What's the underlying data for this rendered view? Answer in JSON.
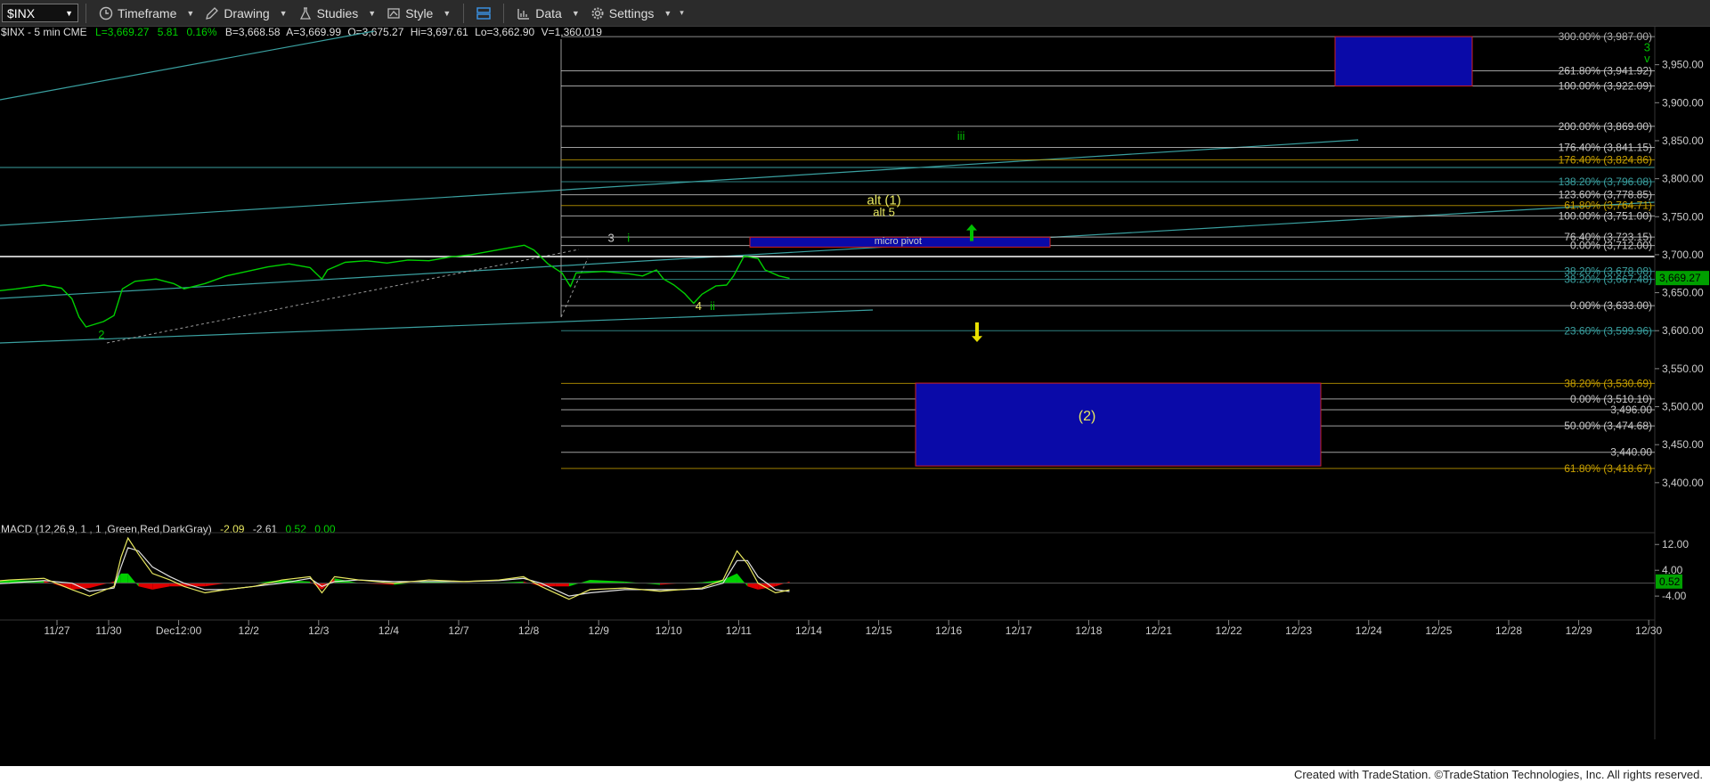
{
  "toolbar": {
    "symbol": "$INX",
    "timeframe": "Timeframe",
    "drawing": "Drawing",
    "studies": "Studies",
    "style": "Style",
    "data": "Data",
    "settings": "Settings"
  },
  "header": {
    "symbol_info": "$INX - 5 min  CME",
    "last": "L=3,669.27",
    "change": "5.81",
    "pct": "0.16%",
    "bid": "B=3,668.58",
    "ask": "A=3,669.99",
    "open": "O=3,675.27",
    "high": "Hi=3,697.61",
    "low": "Lo=3,662.90",
    "volume": "V=1,360,019"
  },
  "footer": {
    "credit": "Created with TradeStation. ©TradeStation Technologies, Inc. All rights reserved."
  },
  "colors": {
    "up": "#00d000",
    "down": "#e00000",
    "signal": "#e8e860",
    "fib_teal": "#3aa0a0",
    "box_blue": "#0a0aa8"
  },
  "chart_data": {
    "type": "line",
    "title": "$INX - 5 min",
    "price_axis": {
      "ylim": [
        3367,
        4000
      ],
      "ticks": [
        "3,950.00",
        "3,900.00",
        "3,850.00",
        "3,800.00",
        "3,750.00",
        "3,700.00",
        "3,650.00",
        "3,600.00",
        "3,550.00",
        "3,500.00",
        "3,450.00",
        "3,400.00"
      ],
      "tick_values": [
        3950,
        3900,
        3850,
        3800,
        3750,
        3700,
        3650,
        3600,
        3550,
        3500,
        3450,
        3400
      ],
      "last_price_label": "3,669.27",
      "last_price": 3669.27
    },
    "x_axis": {
      "labels": [
        "11/27",
        "11/30",
        "Dec12:00",
        "12/2",
        "12/3",
        "12/4",
        "12/7",
        "12/8",
        "12/9",
        "12/10",
        "12/11",
        "12/14",
        "12/15",
        "12/16",
        "12/17",
        "12/18",
        "12/21",
        "12/22",
        "12/23",
        "12/24",
        "12/25",
        "12/28",
        "12/29",
        "12/30"
      ],
      "index": [
        -1,
        0,
        1,
        2,
        3,
        4,
        5,
        6,
        7,
        8,
        9,
        10,
        11,
        12,
        13,
        14,
        15,
        16,
        17,
        18,
        19,
        20,
        21,
        22
      ]
    },
    "price_series": {
      "name": "$INX",
      "points": [
        [
          -2,
          3648
        ],
        [
          -1.7,
          3652
        ],
        [
          -1.4,
          3655
        ],
        [
          -1.0,
          3660
        ],
        [
          -0.75,
          3656
        ],
        [
          -0.6,
          3642
        ],
        [
          -0.5,
          3618
        ],
        [
          -0.4,
          3605
        ],
        [
          -0.15,
          3612
        ],
        [
          0.0,
          3620
        ],
        [
          0.12,
          3655
        ],
        [
          0.3,
          3665
        ],
        [
          0.6,
          3668
        ],
        [
          0.85,
          3662
        ],
        [
          1.0,
          3655
        ],
        [
          1.3,
          3662
        ],
        [
          1.6,
          3672
        ],
        [
          1.9,
          3678
        ],
        [
          2.2,
          3684
        ],
        [
          2.5,
          3688
        ],
        [
          2.8,
          3683
        ],
        [
          2.97,
          3668
        ],
        [
          3.05,
          3680
        ],
        [
          3.3,
          3690
        ],
        [
          3.6,
          3692
        ],
        [
          3.9,
          3689
        ],
        [
          4.2,
          3693
        ],
        [
          4.5,
          3692
        ],
        [
          4.8,
          3697
        ],
        [
          5.1,
          3700
        ],
        [
          5.4,
          3705
        ],
        [
          5.7,
          3710
        ],
        [
          5.86,
          3712.5
        ],
        [
          6.0,
          3706
        ],
        [
          6.2,
          3688
        ],
        [
          6.4,
          3676
        ],
        [
          6.52,
          3658
        ],
        [
          6.6,
          3676
        ],
        [
          7.0,
          3678
        ],
        [
          7.35,
          3675
        ],
        [
          7.55,
          3672
        ],
        [
          7.75,
          3680
        ],
        [
          7.85,
          3668
        ],
        [
          8.0,
          3660
        ],
        [
          8.15,
          3649
        ],
        [
          8.28,
          3636
        ],
        [
          8.4,
          3648
        ],
        [
          8.6,
          3659
        ],
        [
          8.75,
          3660
        ],
        [
          8.85,
          3672
        ],
        [
          9.0,
          3698
        ],
        [
          9.2,
          3695
        ],
        [
          9.3,
          3680
        ],
        [
          9.5,
          3672
        ],
        [
          9.65,
          3669
        ]
      ]
    },
    "macd": {
      "label": "MACD (12,26,9, 1 , 1 ,Green,Red,DarkGray)",
      "macd_value": "-2.09",
      "signal_value": "-2.61",
      "histogram_value": "0.52",
      "zero_value": "0.00",
      "axis_ticks": [
        "12.00",
        "4.00",
        "-4.00"
      ],
      "axis_tick_values": [
        12,
        4,
        -4
      ],
      "last_value_label": "0.52",
      "ylim": [
        -7,
        14
      ],
      "macd_line": [
        [
          -2,
          0
        ],
        [
          -1.5,
          1
        ],
        [
          -1.0,
          1.5
        ],
        [
          -0.6,
          -2
        ],
        [
          -0.35,
          -4
        ],
        [
          0.0,
          -1
        ],
        [
          0.1,
          8
        ],
        [
          0.2,
          14
        ],
        [
          0.35,
          9
        ],
        [
          0.55,
          3
        ],
        [
          0.8,
          1
        ],
        [
          1.0,
          -1
        ],
        [
          1.3,
          -3
        ],
        [
          1.6,
          -2
        ],
        [
          2.0,
          -1
        ],
        [
          2.4,
          1
        ],
        [
          2.8,
          2
        ],
        [
          2.97,
          -3
        ],
        [
          3.15,
          2
        ],
        [
          3.5,
          1
        ],
        [
          4.0,
          0
        ],
        [
          4.5,
          1
        ],
        [
          5.0,
          0.5
        ],
        [
          5.5,
          1
        ],
        [
          5.85,
          2
        ],
        [
          6.1,
          -1
        ],
        [
          6.3,
          -3
        ],
        [
          6.5,
          -5
        ],
        [
          6.8,
          -2
        ],
        [
          7.3,
          -1.5
        ],
        [
          7.8,
          -2.5
        ],
        [
          8.1,
          -2
        ],
        [
          8.4,
          -1.5
        ],
        [
          8.7,
          1
        ],
        [
          8.9,
          10
        ],
        [
          9.05,
          6
        ],
        [
          9.2,
          0
        ],
        [
          9.45,
          -3
        ],
        [
          9.65,
          -2.1
        ]
      ],
      "signal_line": [
        [
          -2,
          -0.5
        ],
        [
          -1.5,
          0
        ],
        [
          -1.0,
          0.8
        ],
        [
          -0.6,
          0
        ],
        [
          -0.35,
          -2.5
        ],
        [
          0.0,
          -1.5
        ],
        [
          0.1,
          5
        ],
        [
          0.2,
          11
        ],
        [
          0.35,
          10
        ],
        [
          0.55,
          5
        ],
        [
          0.8,
          2
        ],
        [
          1.0,
          0
        ],
        [
          1.3,
          -2
        ],
        [
          1.6,
          -2
        ],
        [
          2.0,
          -1
        ],
        [
          2.4,
          0
        ],
        [
          2.8,
          1.5
        ],
        [
          2.97,
          -1
        ],
        [
          3.15,
          0.5
        ],
        [
          3.5,
          1
        ],
        [
          4.0,
          0.5
        ],
        [
          4.5,
          0.5
        ],
        [
          5.0,
          0.5
        ],
        [
          5.5,
          0.8
        ],
        [
          5.85,
          1.5
        ],
        [
          6.1,
          0
        ],
        [
          6.3,
          -2
        ],
        [
          6.5,
          -4
        ],
        [
          6.8,
          -3
        ],
        [
          7.3,
          -2
        ],
        [
          7.8,
          -2
        ],
        [
          8.1,
          -2
        ],
        [
          8.4,
          -1.8
        ],
        [
          8.7,
          0
        ],
        [
          8.9,
          7
        ],
        [
          9.05,
          7
        ],
        [
          9.2,
          2
        ],
        [
          9.45,
          -2
        ],
        [
          9.65,
          -2.6
        ]
      ]
    },
    "fib_levels": [
      {
        "label": "300.00% (3,987.00)",
        "value": 3987,
        "color": "#b0b0b0"
      },
      {
        "label": "261.80% (3,941.92)",
        "value": 3941.92,
        "color": "#c8c8c8"
      },
      {
        "label": "100.00% (3,922.09)",
        "value": 3922.09,
        "color": "#c8c8c8"
      },
      {
        "label": "200.00% (3,869.00)",
        "value": 3869,
        "color": "#c8c8c8"
      },
      {
        "label": "176.40% (3,841.15)",
        "value": 3841.15,
        "color": "#c8c8c8"
      },
      {
        "label": "176.40% (3,824.86)",
        "value": 3824.86,
        "color": "#c8a000"
      },
      {
        "label": "138.20% (3,796.08)",
        "value": 3796.08,
        "color": "#3aa0a0"
      },
      {
        "label": "123.60% (3,778.85)",
        "value": 3778.85,
        "color": "#c8c8c8"
      },
      {
        "label": "61.80% (3,764.71)",
        "value": 3764.71,
        "color": "#c8a000"
      },
      {
        "label": "100.00% (3,751.00)",
        "value": 3751,
        "color": "#c8c8c8"
      },
      {
        "label": "76.40% (3,723.15)",
        "value": 3723.15,
        "color": "#c8c8c8"
      },
      {
        "label": "0.00% (3,712.00)",
        "value": 3712,
        "color": "#c8c8c8"
      },
      {
        "label": "38.20% (3,678.08)",
        "value": 3678.08,
        "color": "#3aa0a0"
      },
      {
        "label": "38.20% (3,667.48)",
        "value": 3667.48,
        "color": "#3aa0a0"
      },
      {
        "label": "0.00% (3,633.00)",
        "value": 3633,
        "color": "#c8c8c8"
      },
      {
        "label": "23.60% (3,599.96)",
        "value": 3599.96,
        "color": "#3aa0a0"
      },
      {
        "label": "38.20% (3,530.69)",
        "value": 3530.69,
        "color": "#c8a000"
      },
      {
        "label": "0.00% (3,510.10)",
        "value": 3510.1,
        "color": "#c8c8c8"
      },
      {
        "label": "3,496.00",
        "value": 3496,
        "color": "#c8c8c8"
      },
      {
        "label": "50.00% (3,474.68)",
        "value": 3474.68,
        "color": "#c8c8c8"
      },
      {
        "label": "3,440.00",
        "value": 3440,
        "color": "#c8c8c8"
      },
      {
        "label": "61.80% (3,418.67)",
        "value": 3418.67,
        "color": "#c8a000"
      }
    ],
    "annotations": [
      {
        "text": "3",
        "x": 21.9,
        "price": 3968,
        "color": "#00c000"
      },
      {
        "text": "v",
        "x": 21.9,
        "price": 3953,
        "color": "#00c000"
      },
      {
        "text": "iii",
        "x": 12.1,
        "price": 3851,
        "color": "#00c000"
      },
      {
        "text": "alt (1)",
        "x": 11.0,
        "price": 3766,
        "color": "#e8e860"
      },
      {
        "text": "alt 5",
        "x": 11.0,
        "price": 3751,
        "color": "#e8e860"
      },
      {
        "text": "3",
        "x": 7.1,
        "price": 3717,
        "color": "#cccccc"
      },
      {
        "text": "i",
        "x": 7.35,
        "price": 3717,
        "color": "#00c000"
      },
      {
        "text": "4",
        "x": 8.35,
        "price": 3627,
        "color": "#e8e860"
      },
      {
        "text": "ii",
        "x": 8.55,
        "price": 3627,
        "color": "#00c000"
      },
      {
        "text": "2",
        "x": -0.18,
        "price": 3590,
        "color": "#00c000"
      },
      {
        "text": "micro pivot",
        "x": 11.2,
        "price": 3714,
        "color": "#cccccc"
      },
      {
        "text": "(2)",
        "x": 13.9,
        "price": 3482,
        "color": "#e8e860"
      }
    ]
  }
}
